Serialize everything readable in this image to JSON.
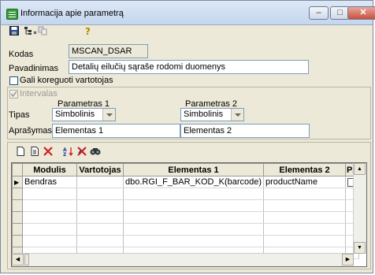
{
  "window": {
    "title": "Informacija apie parametrą"
  },
  "form": {
    "kodas_label": "Kodas",
    "kodas_value": "MSCAN_DSAR",
    "pavadinimas_label": "Pavadinimas",
    "pavadinimas_value": "Detalių eilučių sąraše rodomi duomenys",
    "editable_label": "Gali koreguoti vartotojas",
    "interval_label": "Intervalas",
    "param1_label": "Parametras 1",
    "param2_label": "Parametras 2",
    "tipas_label": "Tipas",
    "tipas1_value": "Simbolinis",
    "tipas2_value": "Simbolinis",
    "aprasymas_label": "Aprašymas",
    "aprasymas1_value": "Elementas 1",
    "aprasymas2_value": "Elementas 2"
  },
  "grid": {
    "columns": [
      "Modulis",
      "Vartotojas",
      "Elementas 1",
      "Elementas 2",
      "PŽ"
    ],
    "rows": [
      {
        "modulis": "Bendras",
        "vartotojas": "",
        "el1": "dbo.RGI_F_BAR_KOD_K(barcode)",
        "el2": "productName",
        "pz": false
      }
    ]
  },
  "colors": {
    "titlebar": "#c4d6ee",
    "face": "#ece9d8",
    "input_border": "#7f9db9"
  }
}
